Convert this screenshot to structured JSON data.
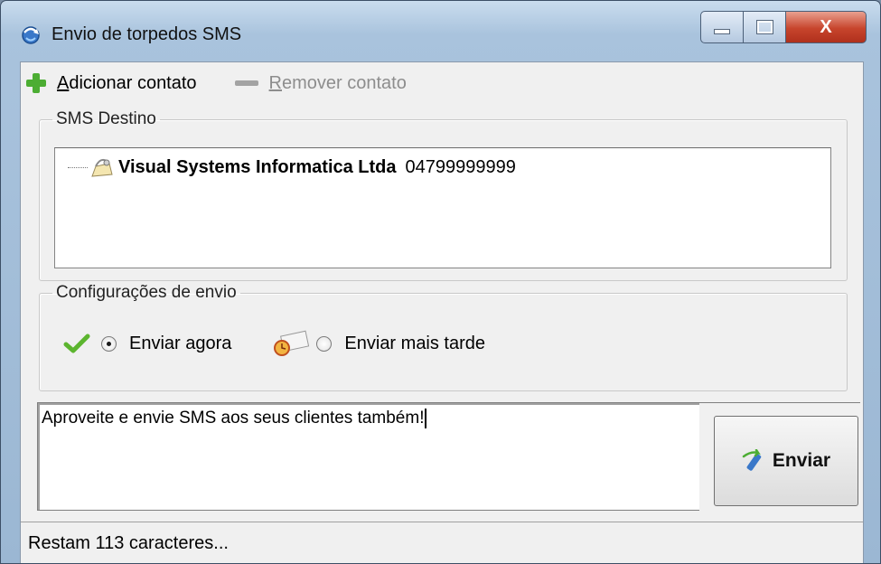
{
  "window": {
    "title": "Envio de torpedos SMS",
    "icon": "globe-arrows-icon",
    "controls": {
      "minimize": "minimize-icon",
      "maximize": "maximize-icon",
      "close": "X"
    }
  },
  "toolbar": {
    "add": {
      "accel": "A",
      "rest": "dicionar contato",
      "icon": "plus-icon",
      "enabled": true
    },
    "remove": {
      "accel": "R",
      "rest": "emover contato",
      "icon": "minus-icon",
      "enabled": false
    }
  },
  "destination_group": {
    "legend": "SMS Destino",
    "contacts": [
      {
        "name": "Visual Systems Informatica Ltda",
        "phone": "04799999999",
        "icon": "contact-icon"
      }
    ]
  },
  "send_config": {
    "legend": "Configurações de envio",
    "options": [
      {
        "label": "Enviar agora",
        "selected": true,
        "icon": "checkmark-icon"
      },
      {
        "label": "Enviar mais tarde",
        "selected": false,
        "icon": "clock-envelope-icon"
      }
    ]
  },
  "message": {
    "value": "Aproveite e envie SMS aos seus clientes também!"
  },
  "send_button": {
    "label": "Enviar",
    "icon": "send-arrow-icon"
  },
  "status": {
    "text": "Restam 113 caracteres..."
  },
  "colors": {
    "title_gradient": "#9bb7d3",
    "close_button": "#c7442c",
    "plus_green": "#4cad33"
  }
}
